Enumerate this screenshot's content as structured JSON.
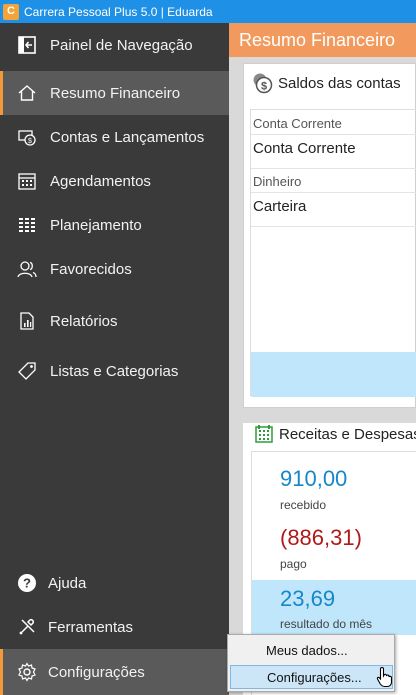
{
  "window": {
    "title": "Carrera Pessoal Plus 5.0 | Eduarda"
  },
  "sidebar": {
    "items": [
      {
        "label": "Painel de Navegação",
        "icon": "panel-collapse-icon",
        "active": false
      },
      {
        "label": "Resumo Financeiro",
        "icon": "home-icon",
        "active": true
      },
      {
        "label": "Contas e Lançamentos",
        "icon": "accounts-icon",
        "active": false
      },
      {
        "label": "Agendamentos",
        "icon": "calendar-icon",
        "active": false
      },
      {
        "label": "Planejamento",
        "icon": "planning-grid-icon",
        "active": false
      },
      {
        "label": "Favorecidos",
        "icon": "people-icon",
        "active": false
      },
      {
        "label": "Relatórios",
        "icon": "report-icon",
        "active": false
      },
      {
        "label": "Listas e Categorias",
        "icon": "tag-icon",
        "active": false
      }
    ],
    "bottom": [
      {
        "label": "Ajuda",
        "icon": "help-icon"
      },
      {
        "label": "Ferramentas",
        "icon": "tools-icon"
      },
      {
        "label": "Configurações",
        "icon": "gear-icon"
      }
    ]
  },
  "main": {
    "header": "Resumo Financeiro",
    "balances": {
      "title": "Saldos das contas",
      "groups": [
        {
          "label": "Conta Corrente",
          "accounts": [
            "Conta Corrente"
          ]
        },
        {
          "label": "Dinheiro",
          "accounts": [
            "Carteira"
          ]
        }
      ]
    },
    "income_expenses": {
      "title": "Receitas e Despesas",
      "received": {
        "value": "910,00",
        "label": "recebido"
      },
      "paid": {
        "value": "(886,31)",
        "label": "pago"
      },
      "result": {
        "value": "23,69",
        "label": "resultado do mês"
      }
    }
  },
  "context_menu": {
    "items": [
      {
        "label": "Meus dados..."
      },
      {
        "label": "Configurações..."
      }
    ]
  },
  "colors": {
    "titlebar": "#1e90e6",
    "sidebar": "#3a3a3a",
    "accent": "#f29a5e",
    "positive": "#1787c9",
    "negative": "#b11a1a",
    "highlight": "#bfe6fb"
  }
}
